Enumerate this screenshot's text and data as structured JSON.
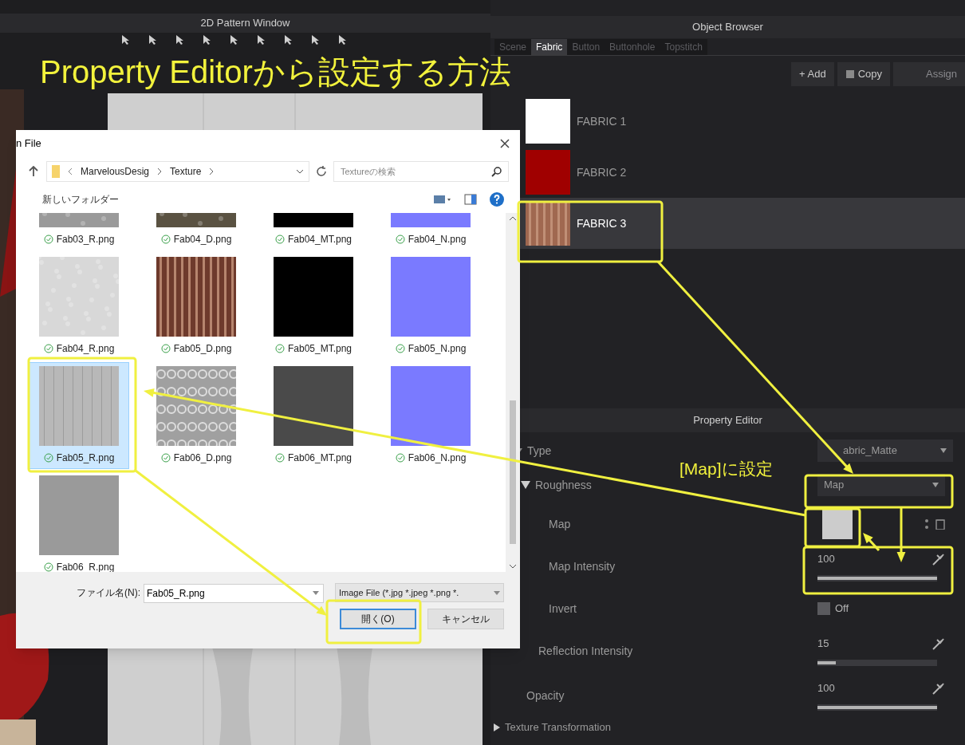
{
  "annotation_title": "Property Editorから設定する方法",
  "annotation_note": "[Map]に設定",
  "pattern_window": {
    "title": "2D Pattern Window"
  },
  "object_browser": {
    "title": "Object Browser",
    "tabs": [
      {
        "label": "Scene",
        "selected": false
      },
      {
        "label": "Fabric",
        "selected": true
      },
      {
        "label": "Button",
        "selected": false
      },
      {
        "label": "Buttonhole",
        "selected": false
      },
      {
        "label": "Topstitch",
        "selected": false
      }
    ],
    "buttons": [
      {
        "label": "+ Add",
        "kind": "add"
      },
      {
        "label": "Copy",
        "kind": "copy"
      },
      {
        "label": "Assign",
        "kind": "assign"
      }
    ],
    "fabrics": [
      {
        "name": "FABRIC 1",
        "kind": "solid",
        "color": "#ffffff",
        "selected": false
      },
      {
        "name": "FABRIC 2",
        "kind": "solid",
        "color": "#a00000",
        "selected": false
      },
      {
        "name": "FABRIC 3",
        "kind": "stripes",
        "color": "#a06850",
        "selected": true
      }
    ]
  },
  "property_editor": {
    "title": "Property Editor",
    "type": {
      "label": "Type",
      "value": "abric_Matte"
    },
    "section": {
      "label": "Roughness",
      "expanded": true,
      "mode": "Map"
    },
    "rows": [
      {
        "kind": "map",
        "label": "Map"
      },
      {
        "kind": "slider",
        "label": "Map Intensity",
        "reading": "100",
        "level": 1
      },
      {
        "kind": "toggle",
        "label": "Invert",
        "reading": "Off",
        "checked": false
      },
      {
        "kind": "slider",
        "label": "Reflection Intensity",
        "reading": "15",
        "level": 0.15
      },
      {
        "kind": "slider",
        "label": "Opacity",
        "reading": "100",
        "level": 1
      }
    ],
    "next_section": {
      "label": "Texture Transformation",
      "expanded": false
    }
  },
  "dialog": {
    "title": "n File",
    "path": [
      "MarvelousDesig",
      "Texture"
    ],
    "search_placeholder": "Textureの検索",
    "new_folder": "新しいフォルダー",
    "files": [
      {
        "name": "Fab03_R.png",
        "kind": "noise",
        "color": "#9a9a9a",
        "selected": false
      },
      {
        "name": "Fab04_D.png",
        "kind": "noise",
        "color": "#5a5242",
        "selected": false
      },
      {
        "name": "Fab04_MT.png",
        "kind": "solid",
        "color": "#000000",
        "selected": false
      },
      {
        "name": "Fab04_N.png",
        "kind": "solid",
        "color": "#7a7aff",
        "selected": false
      },
      {
        "name": "Fab04_R.png",
        "kind": "noise",
        "color": "#d8d8d8",
        "selected": false
      },
      {
        "name": "Fab05_D.png",
        "kind": "stripes",
        "color": "#6e3a2c",
        "selected": false
      },
      {
        "name": "Fab05_MT.png",
        "kind": "solid",
        "color": "#000000",
        "selected": false
      },
      {
        "name": "Fab05_N.png",
        "kind": "solid",
        "color": "#7a7aff",
        "selected": false
      },
      {
        "name": "Fab05_R.png",
        "kind": "lines",
        "color": "#b8b8b8",
        "selected": true
      },
      {
        "name": "Fab06_D.png",
        "kind": "mesh",
        "color": "#a0a0a0",
        "selected": false
      },
      {
        "name": "Fab06_MT.png",
        "kind": "solid",
        "color": "#4a4a4a",
        "selected": false
      },
      {
        "name": "Fab06_N.png",
        "kind": "solid",
        "color": "#7a7aff",
        "selected": false
      },
      {
        "name": "Fab06_R.png",
        "kind": "solid",
        "color": "#9a9a9a",
        "selected": false
      }
    ],
    "filename_label": "ファイル名(N):",
    "filename": "Fab05_R.png",
    "filter": "Image File (*.jpg *.jpeg *.png *.",
    "buttons": [
      {
        "label": "開く(O)",
        "primary": true
      },
      {
        "label": "キャンセル",
        "primary": false
      }
    ]
  }
}
